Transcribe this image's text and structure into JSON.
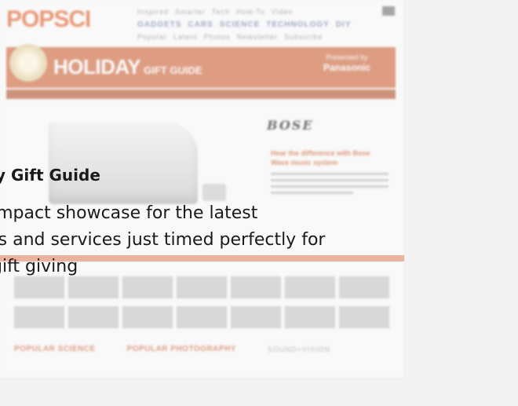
{
  "site": {
    "logo": "POPSCI",
    "nav_top": [
      "Inspired",
      "Smarter",
      "Tech",
      "How-To",
      "Video"
    ],
    "nav_main": [
      "GADGETS",
      "CARS",
      "SCIENCE",
      "TECHNOLOGY",
      "DIY"
    ],
    "nav_bottom": [
      "Popular",
      "Latest",
      "Photos",
      "Newsletter",
      "Subscribe"
    ]
  },
  "banner": {
    "title": "HOLIDAY",
    "subtitle": "GIFT GUIDE",
    "sponsor_presented": "Presented by",
    "sponsor_name": "Panasonic"
  },
  "promo": {
    "brand": "BOSE",
    "headline": "Hear the difference with Bose Wave music system"
  },
  "thumbs": {
    "row1": [
      "",
      "",
      "",
      "",
      "",
      "",
      ""
    ],
    "row2": [
      "",
      "",
      "",
      "",
      "",
      "",
      ""
    ]
  },
  "partners": [
    "POPULAR SCIENCE",
    "POPULAR PHOTOGRAPHY",
    "SOUND+VISION"
  ],
  "caption": {
    "title": "y Gift Guide",
    "line1": "impact showcase for the latest",
    "line2": "ts and services just timed perfectly for",
    "line3": "gift giving"
  },
  "colors": {
    "accent": "#d26a40",
    "caption_text": "#1a1a1a",
    "stripe": "#e9a089"
  }
}
